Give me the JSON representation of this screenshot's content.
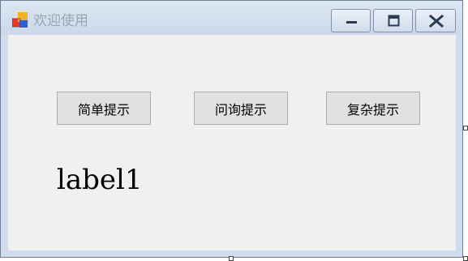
{
  "window": {
    "title": "欢迎使用"
  },
  "buttons": {
    "simple": "简单提示",
    "ask": "问询提示",
    "complex": "复杂提示"
  },
  "label": {
    "text": "label1"
  },
  "icons": {
    "app": "app-icon",
    "minimize": "minimize-icon",
    "maximize": "maximize-icon",
    "close": "close-icon"
  }
}
